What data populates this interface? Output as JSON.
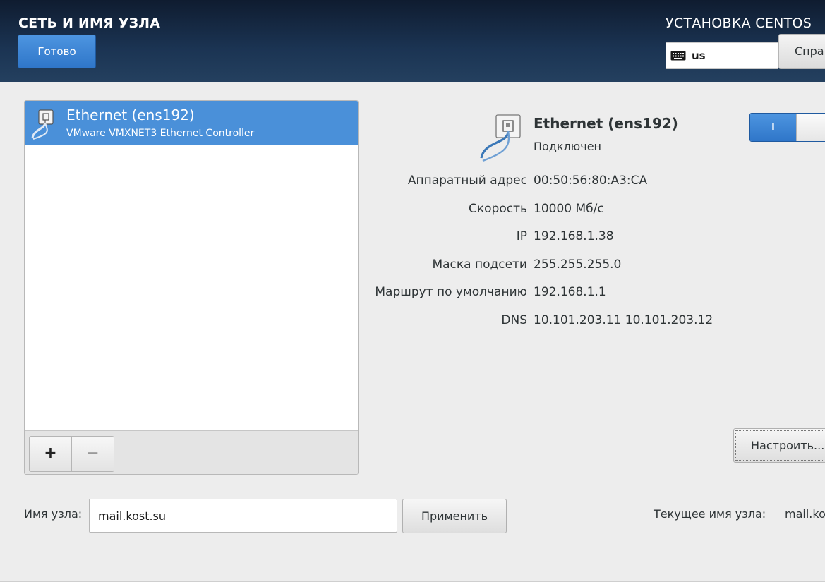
{
  "header": {
    "spoke_title": "СЕТЬ И ИМЯ УЗЛА",
    "done_label": "Готово",
    "product_title": "УСТАНОВКА CENTOS",
    "keyboard_layout": "us",
    "help_label": "Справка!"
  },
  "device_list": {
    "items": [
      {
        "name": "Ethernet (ens192)",
        "description": "VMware VMXNET3 Ethernet Controller",
        "selected": true,
        "icon": "network-wired-icon"
      }
    ],
    "add_label": "+",
    "remove_label": "−"
  },
  "device": {
    "name": "Ethernet (ens192)",
    "status": "Подключен",
    "toggle_on_label": "I",
    "toggle_state": "on",
    "details": [
      {
        "label": "Аппаратный адрес",
        "value": "00:50:56:80:A3:CA"
      },
      {
        "label": "Скорость",
        "value": "10000 Мб/с"
      },
      {
        "label": "IP",
        "value": "192.168.1.38"
      },
      {
        "label": "Маска подсети",
        "value": "255.255.255.0"
      },
      {
        "label": "Маршрут по умолчанию",
        "value": "192.168.1.1"
      },
      {
        "label": "DNS",
        "value": "10.101.203.11 10.101.203.12"
      }
    ],
    "configure_label": "Настроить..."
  },
  "hostname": {
    "label": "Имя узла:",
    "value": "mail.kost.su",
    "apply_label": "Применить",
    "current_label": "Текущее имя узла:",
    "current_value": "mail.kost.su"
  },
  "colors": {
    "accent": "#4a90d9",
    "header_dark": "#0f1c30",
    "background": "#ededed"
  }
}
